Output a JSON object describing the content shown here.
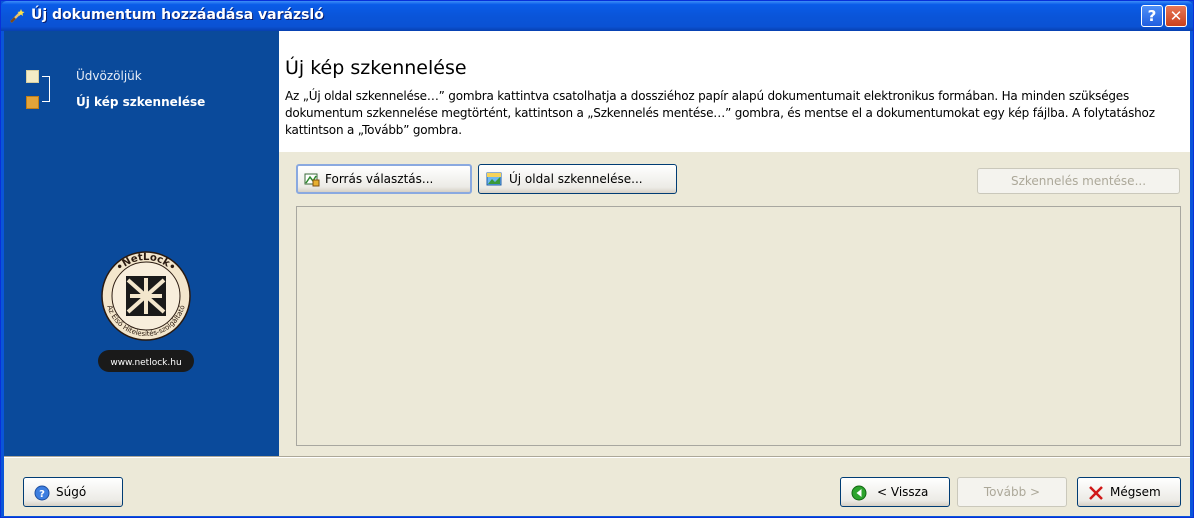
{
  "window": {
    "title": "Új dokumentum hozzáadása varázsló",
    "help_icon": "help-question-icon",
    "close_icon": "close-x-icon"
  },
  "sidebar": {
    "steps": [
      {
        "label": "Üdvözöljük",
        "state": "done"
      },
      {
        "label": "Új kép szkennelése",
        "state": "current"
      }
    ],
    "logo": {
      "name": "NetLock",
      "ring_text": "Az Első Hitelesítés-szolgáltató",
      "url": "www.netlock.hu"
    }
  },
  "main": {
    "title": "Új kép szkennelése",
    "description": "Az „Új oldal szkennelése…” gombra kattintva csatolhatja a dossziéhoz papír alapú dokumentumait elektronikus formában. Ha minden szükséges dokumentum szkennelése megtörtént, kattintson a „Szkennelés mentése…” gombra, és mentse el a dokumentumokat egy kép fájlba. A folytatáshoz kattintson a „Tovább” gombra.",
    "buttons": {
      "source": "Forrás választás...",
      "scan": "Új oldal szkennelése...",
      "save": "Szkennelés mentése..."
    }
  },
  "footer": {
    "help": "Súgó",
    "back": "< Vissza",
    "next": "Tovább >",
    "cancel": "Mégsem"
  },
  "colors": {
    "titlebar": "#0a55d9",
    "sidebar": "#0a4a9b",
    "dialog_bg": "#ece9d8",
    "disabled_text": "#aca899"
  }
}
